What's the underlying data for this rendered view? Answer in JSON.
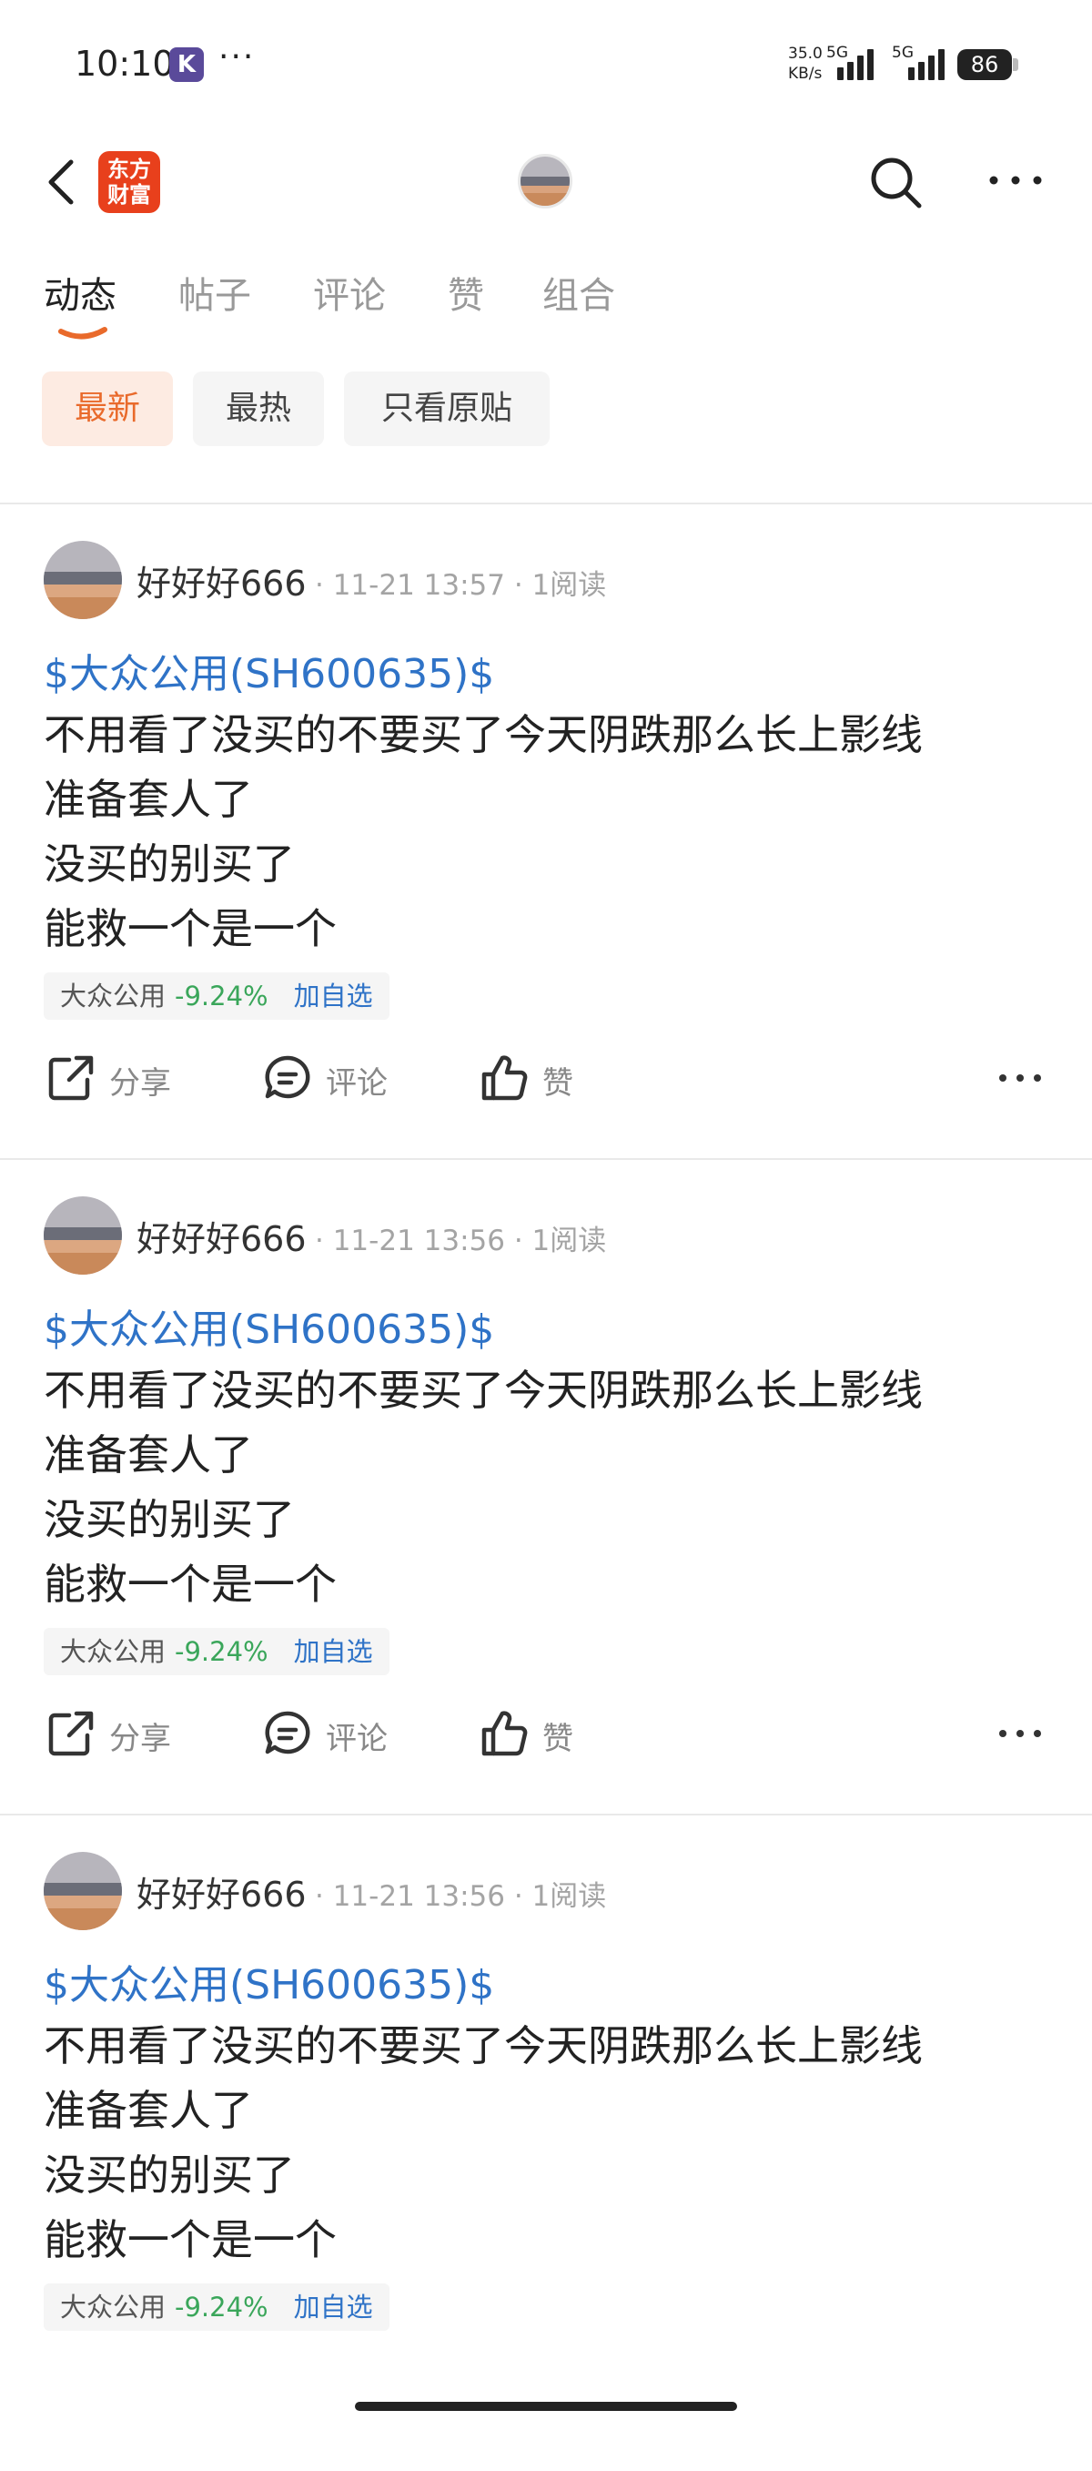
{
  "status": {
    "time": "10:10",
    "app_badge": "K",
    "dots": "···",
    "speed_top": "35.0",
    "speed_bottom": "KB/s",
    "net1": "5G",
    "net2": "5G",
    "battery": "86"
  },
  "header": {
    "logo_line1": "东方",
    "logo_line2": "财富",
    "icons": [
      "back-icon",
      "search-icon",
      "more-icon"
    ],
    "brand_color": "#e8401c"
  },
  "tabs": [
    {
      "label": "动态",
      "active": true
    },
    {
      "label": "帖子",
      "active": false
    },
    {
      "label": "评论",
      "active": false
    },
    {
      "label": "赞",
      "active": false
    },
    {
      "label": "组合",
      "active": false
    }
  ],
  "filters": [
    {
      "label": "最新",
      "active": true
    },
    {
      "label": "最热",
      "active": false
    },
    {
      "label": "只看原贴",
      "active": false
    }
  ],
  "actions": {
    "share": "分享",
    "comment": "评论",
    "like": "赞"
  },
  "posts": [
    {
      "user": "好好好666",
      "meta": "· 11-21 13:57 · 1阅读",
      "tag": "$大众公用(SH600635)$",
      "lines": [
        "不用看了没买的不要买了今天阴跌那么长上影线",
        "准备套人了",
        "没买的别买了",
        "能救一个是一个"
      ],
      "stock": {
        "name": "大众公用",
        "change": "-9.24%",
        "add": "加自选"
      }
    },
    {
      "user": "好好好666",
      "meta": "· 11-21 13:56 · 1阅读",
      "tag": "$大众公用(SH600635)$",
      "lines": [
        "不用看了没买的不要买了今天阴跌那么长上影线",
        "准备套人了",
        "没买的别买了",
        "能救一个是一个"
      ],
      "stock": {
        "name": "大众公用",
        "change": "-9.24%",
        "add": "加自选"
      }
    },
    {
      "user": "好好好666",
      "meta": "· 11-21 13:56 · 1阅读",
      "tag": "$大众公用(SH600635)$",
      "lines": [
        "不用看了没买的不要买了今天阴跌那么长上影线",
        "准备套人了",
        "没买的别买了",
        "能救一个是一个"
      ],
      "stock": {
        "name": "大众公用",
        "change": "-9.24%",
        "add": "加自选"
      }
    }
  ],
  "colors": {
    "accent": "#e96a2b",
    "link": "#2f73c7",
    "down": "#3aa65a"
  }
}
